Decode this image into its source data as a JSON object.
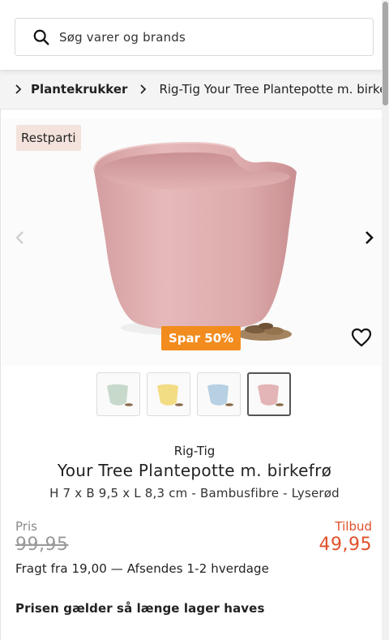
{
  "search": {
    "placeholder": "Søg varer og brands",
    "icon": "search-icon"
  },
  "breadcrumb": {
    "items": [
      "Plantekrukker",
      "Rig-Tig Your Tree Plantepotte m. birkefrø"
    ]
  },
  "gallery": {
    "badge": "Restparti",
    "discount_badge": "Spar 50%",
    "colors": {
      "pot_pink": "#e3b5b6",
      "discount": "#f28c1e"
    },
    "thumbnails": [
      {
        "color": "#c7d9cb",
        "label": "green"
      },
      {
        "color": "#f2dc84",
        "label": "yellow"
      },
      {
        "color": "#b7d0e3",
        "label": "blue"
      },
      {
        "color": "#e3b5b6",
        "label": "pink",
        "active": true
      }
    ]
  },
  "product": {
    "brand": "Rig-Tig",
    "title": "Your Tree Plantepotte m. birkefrø",
    "specs": "H 7 x B 9,5 x L 8,3 cm - Bambusfibre - Lyserød"
  },
  "pricing": {
    "price_label": "Pris",
    "old_price": "99,95",
    "offer_label": "Tilbud",
    "new_price": "49,95",
    "shipping": "Fragt fra 19,00 — Afsendes 1-2 hverdage",
    "note": "Prisen gælder så længe lager haves"
  }
}
